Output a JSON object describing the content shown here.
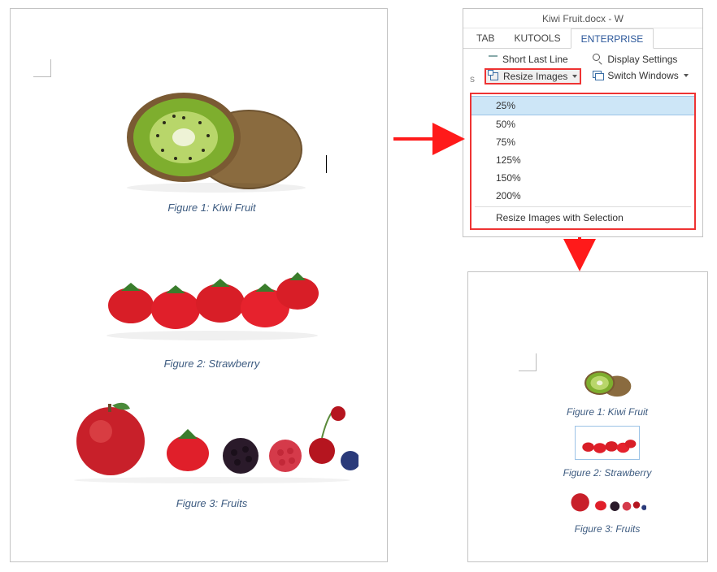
{
  "window_title": "Kiwi Fruit.docx - W",
  "tabs": {
    "tab": "TAB",
    "kutools": "KUTOOLS",
    "enterprise": "ENTERPRISE"
  },
  "ribbon": {
    "left_stub": "s",
    "short_last_line": "Short Last Line",
    "resize_images": "Resize Images",
    "display_settings": "Display Settings",
    "switch_windows": "Switch Windows"
  },
  "resize_menu": {
    "pct25": "25%",
    "pct50": "50%",
    "pct75": "75%",
    "pct125": "125%",
    "pct150": "150%",
    "pct200": "200%",
    "with_selection": "Resize Images with Selection"
  },
  "captions": {
    "fig1": "Figure 1: Kiwi Fruit",
    "fig2": "Figure 2: Strawberry",
    "fig3": "Figure 3: Fruits"
  }
}
